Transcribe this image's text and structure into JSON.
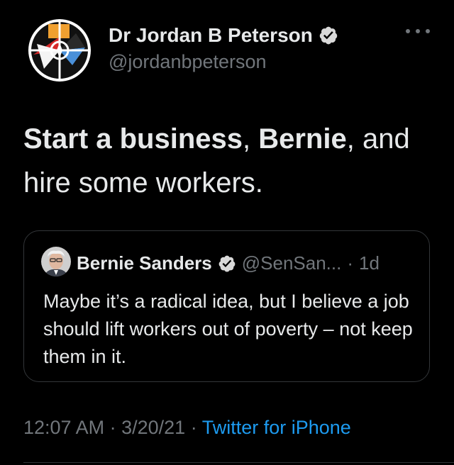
{
  "author": {
    "name": "Dr Jordan B Peterson",
    "handle": "@jordanbpeterson",
    "avatar_icon": "maps-of-meaning-icon"
  },
  "tweet": {
    "segments": [
      {
        "text": "Start a business",
        "bold": true
      },
      {
        "text": ", ",
        "bold": false
      },
      {
        "text": "Bernie",
        "bold": true
      },
      {
        "text": ", and hire some workers.",
        "bold": false
      }
    ]
  },
  "quoted_tweet": {
    "name": "Bernie Sanders",
    "handle": "@SenSan...",
    "separator": "·",
    "age": "1d",
    "text": "Maybe it’s a radical idea, but I believe a job should lift workers out of poverty – not keep them in it."
  },
  "meta": {
    "time": "12:07 AM",
    "date": "3/20/21",
    "separator": "·",
    "source": "Twitter for iPhone"
  },
  "colors": {
    "background": "#000000",
    "text": "#e7e9ea",
    "muted": "#71767b",
    "link": "#1d9bf0",
    "verified": "#1d9bf0"
  }
}
